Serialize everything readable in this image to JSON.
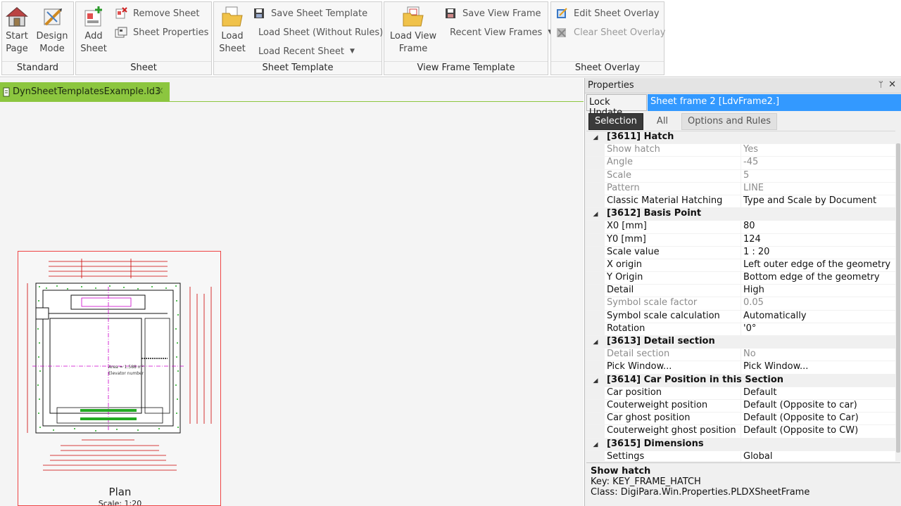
{
  "ribbon": {
    "standard": {
      "label": "Standard",
      "start_page": "Start\nPage",
      "design_mode": "Design\nMode"
    },
    "sheet": {
      "label": "Sheet",
      "add_sheet": "Add\nSheet",
      "remove_sheet": "Remove Sheet",
      "sheet_properties": "Sheet Properties"
    },
    "sheet_template": {
      "label": "Sheet Template",
      "load_sheet": "Load\nSheet",
      "save_template": "Save Sheet Template",
      "load_without_rules": "Load Sheet (Without Rules)",
      "load_recent": "Load Recent Sheet"
    },
    "view_frame_template": {
      "label": "View Frame Template",
      "load_view_frame": "Load View\nFrame",
      "save_view_frame": "Save View Frame",
      "recent_view_frames": "Recent View Frames"
    },
    "sheet_overlay": {
      "label": "Sheet Overlay",
      "edit": "Edit Sheet Overlay",
      "clear": "Clear Sheet Overlay"
    }
  },
  "document": {
    "tab_title": "DynSheetTemplatesExample.ld3",
    "close_glyph": "✕",
    "plan_title": "Plan",
    "plan_scale": "Scale: 1:20",
    "drawing_note_1": "Area = 1.588 m²",
    "drawing_note_2": "Elevator number"
  },
  "properties": {
    "title": "Properties",
    "pin": "ᛘ",
    "close": "✕",
    "lock_update": "Lock Update",
    "frame_name": "Sheet frame 2 [LdvFrame2.]",
    "tabs": [
      "Selection",
      "All",
      "Options and Rules"
    ],
    "rows": [
      {
        "type": "cat",
        "name": "[3611] Hatch"
      },
      {
        "type": "row",
        "name": "Show hatch",
        "value": "Yes",
        "disabled": true
      },
      {
        "type": "row",
        "name": "Angle",
        "value": "-45",
        "disabled": true
      },
      {
        "type": "row",
        "name": "Scale",
        "value": "5",
        "disabled": true
      },
      {
        "type": "row",
        "name": "Pattern",
        "value": "LINE",
        "disabled": true
      },
      {
        "type": "row",
        "name": "Classic Material Hatching",
        "value": "Type and Scale by Document",
        "disabled": false
      },
      {
        "type": "cat",
        "name": "[3612] Basis Point"
      },
      {
        "type": "row",
        "name": "X0 [mm]",
        "value": "80",
        "disabled": false
      },
      {
        "type": "row",
        "name": "Y0 [mm]",
        "value": "124",
        "disabled": false
      },
      {
        "type": "row",
        "name": "Scale value",
        "value": " 1 : 20",
        "disabled": false
      },
      {
        "type": "row",
        "name": "X origin",
        "value": "Left outer edge of the geometry",
        "disabled": false
      },
      {
        "type": "row",
        "name": "Y Origin",
        "value": "Bottom edge of the geometry",
        "disabled": false
      },
      {
        "type": "row",
        "name": "Detail",
        "value": "High",
        "disabled": false
      },
      {
        "type": "row",
        "name": "Symbol scale factor",
        "value": "0.05",
        "disabled": true
      },
      {
        "type": "row",
        "name": "Symbol scale calculation",
        "value": "Automatically",
        "disabled": false
      },
      {
        "type": "row",
        "name": "Rotation",
        "value": "'0°",
        "disabled": false
      },
      {
        "type": "cat",
        "name": "[3613] Detail section"
      },
      {
        "type": "row",
        "name": "Detail section",
        "value": "No",
        "disabled": true
      },
      {
        "type": "row",
        "name": "Pick Window...",
        "value": "Pick Window...",
        "disabled": false
      },
      {
        "type": "cat",
        "name": "[3614] Car Position in this Section"
      },
      {
        "type": "row",
        "name": "Car position",
        "value": "Default",
        "disabled": false
      },
      {
        "type": "row",
        "name": "Couterweight position",
        "value": "Default (Opposite to car)",
        "disabled": false
      },
      {
        "type": "row",
        "name": "Car ghost position",
        "value": "Default (Opposite  to Car)",
        "disabled": false
      },
      {
        "type": "row",
        "name": "Couterweight ghost position",
        "value": "Default (Opposite to CW)",
        "disabled": false
      },
      {
        "type": "cat",
        "name": "[3615] Dimensions"
      },
      {
        "type": "row",
        "name": "Settings",
        "value": "Global",
        "disabled": false
      }
    ],
    "description": {
      "title": "Show hatch",
      "key": "Key: KEY_FRAME_HATCH",
      "class": "Class: DigiPara.Win.Properties.PLDXSheetFrame"
    }
  },
  "colors": {
    "accent": "#3399ff",
    "doc_tab": "#8cc63f",
    "sheet_border": "#ee4444",
    "drawing_hatch": "#22aa22",
    "dimension": "#cc0000",
    "axis": "#cc00cc"
  }
}
